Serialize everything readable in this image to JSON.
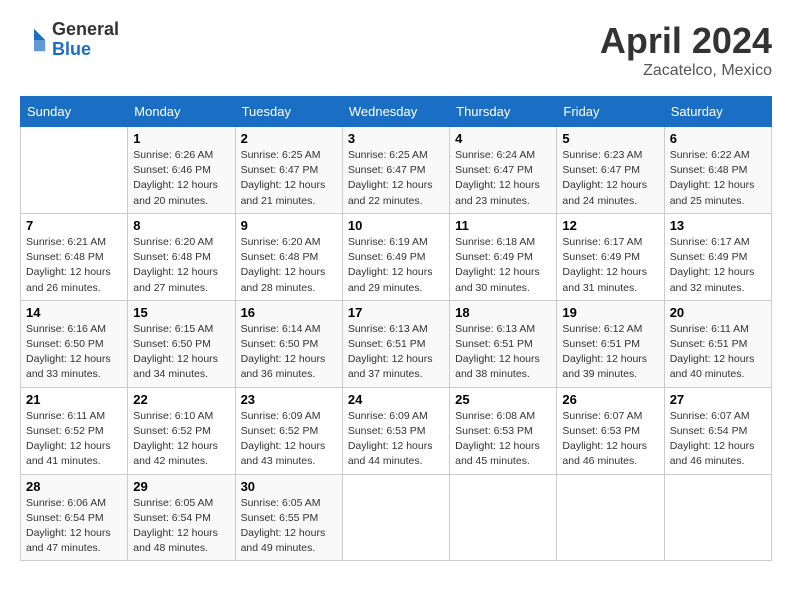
{
  "header": {
    "logo_general": "General",
    "logo_blue": "Blue",
    "month_year": "April 2024",
    "location": "Zacatelco, Mexico"
  },
  "columns": [
    "Sunday",
    "Monday",
    "Tuesday",
    "Wednesday",
    "Thursday",
    "Friday",
    "Saturday"
  ],
  "weeks": [
    [
      {
        "day": "",
        "info": ""
      },
      {
        "day": "1",
        "info": "Sunrise: 6:26 AM\nSunset: 6:46 PM\nDaylight: 12 hours\nand 20 minutes."
      },
      {
        "day": "2",
        "info": "Sunrise: 6:25 AM\nSunset: 6:47 PM\nDaylight: 12 hours\nand 21 minutes."
      },
      {
        "day": "3",
        "info": "Sunrise: 6:25 AM\nSunset: 6:47 PM\nDaylight: 12 hours\nand 22 minutes."
      },
      {
        "day": "4",
        "info": "Sunrise: 6:24 AM\nSunset: 6:47 PM\nDaylight: 12 hours\nand 23 minutes."
      },
      {
        "day": "5",
        "info": "Sunrise: 6:23 AM\nSunset: 6:47 PM\nDaylight: 12 hours\nand 24 minutes."
      },
      {
        "day": "6",
        "info": "Sunrise: 6:22 AM\nSunset: 6:48 PM\nDaylight: 12 hours\nand 25 minutes."
      }
    ],
    [
      {
        "day": "7",
        "info": "Sunrise: 6:21 AM\nSunset: 6:48 PM\nDaylight: 12 hours\nand 26 minutes."
      },
      {
        "day": "8",
        "info": "Sunrise: 6:20 AM\nSunset: 6:48 PM\nDaylight: 12 hours\nand 27 minutes."
      },
      {
        "day": "9",
        "info": "Sunrise: 6:20 AM\nSunset: 6:48 PM\nDaylight: 12 hours\nand 28 minutes."
      },
      {
        "day": "10",
        "info": "Sunrise: 6:19 AM\nSunset: 6:49 PM\nDaylight: 12 hours\nand 29 minutes."
      },
      {
        "day": "11",
        "info": "Sunrise: 6:18 AM\nSunset: 6:49 PM\nDaylight: 12 hours\nand 30 minutes."
      },
      {
        "day": "12",
        "info": "Sunrise: 6:17 AM\nSunset: 6:49 PM\nDaylight: 12 hours\nand 31 minutes."
      },
      {
        "day": "13",
        "info": "Sunrise: 6:17 AM\nSunset: 6:49 PM\nDaylight: 12 hours\nand 32 minutes."
      }
    ],
    [
      {
        "day": "14",
        "info": "Sunrise: 6:16 AM\nSunset: 6:50 PM\nDaylight: 12 hours\nand 33 minutes."
      },
      {
        "day": "15",
        "info": "Sunrise: 6:15 AM\nSunset: 6:50 PM\nDaylight: 12 hours\nand 34 minutes."
      },
      {
        "day": "16",
        "info": "Sunrise: 6:14 AM\nSunset: 6:50 PM\nDaylight: 12 hours\nand 36 minutes."
      },
      {
        "day": "17",
        "info": "Sunrise: 6:13 AM\nSunset: 6:51 PM\nDaylight: 12 hours\nand 37 minutes."
      },
      {
        "day": "18",
        "info": "Sunrise: 6:13 AM\nSunset: 6:51 PM\nDaylight: 12 hours\nand 38 minutes."
      },
      {
        "day": "19",
        "info": "Sunrise: 6:12 AM\nSunset: 6:51 PM\nDaylight: 12 hours\nand 39 minutes."
      },
      {
        "day": "20",
        "info": "Sunrise: 6:11 AM\nSunset: 6:51 PM\nDaylight: 12 hours\nand 40 minutes."
      }
    ],
    [
      {
        "day": "21",
        "info": "Sunrise: 6:11 AM\nSunset: 6:52 PM\nDaylight: 12 hours\nand 41 minutes."
      },
      {
        "day": "22",
        "info": "Sunrise: 6:10 AM\nSunset: 6:52 PM\nDaylight: 12 hours\nand 42 minutes."
      },
      {
        "day": "23",
        "info": "Sunrise: 6:09 AM\nSunset: 6:52 PM\nDaylight: 12 hours\nand 43 minutes."
      },
      {
        "day": "24",
        "info": "Sunrise: 6:09 AM\nSunset: 6:53 PM\nDaylight: 12 hours\nand 44 minutes."
      },
      {
        "day": "25",
        "info": "Sunrise: 6:08 AM\nSunset: 6:53 PM\nDaylight: 12 hours\nand 45 minutes."
      },
      {
        "day": "26",
        "info": "Sunrise: 6:07 AM\nSunset: 6:53 PM\nDaylight: 12 hours\nand 46 minutes."
      },
      {
        "day": "27",
        "info": "Sunrise: 6:07 AM\nSunset: 6:54 PM\nDaylight: 12 hours\nand 46 minutes."
      }
    ],
    [
      {
        "day": "28",
        "info": "Sunrise: 6:06 AM\nSunset: 6:54 PM\nDaylight: 12 hours\nand 47 minutes."
      },
      {
        "day": "29",
        "info": "Sunrise: 6:05 AM\nSunset: 6:54 PM\nDaylight: 12 hours\nand 48 minutes."
      },
      {
        "day": "30",
        "info": "Sunrise: 6:05 AM\nSunset: 6:55 PM\nDaylight: 12 hours\nand 49 minutes."
      },
      {
        "day": "",
        "info": ""
      },
      {
        "day": "",
        "info": ""
      },
      {
        "day": "",
        "info": ""
      },
      {
        "day": "",
        "info": ""
      }
    ]
  ]
}
